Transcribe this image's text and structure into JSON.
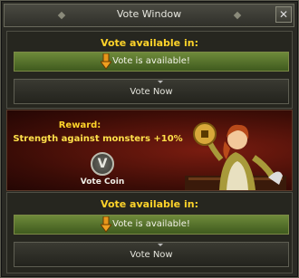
{
  "window": {
    "title": "Vote Window",
    "close_glyph": "✕"
  },
  "sections": [
    {
      "heading": "Vote available in:",
      "status": "Vote is available!",
      "button": "Vote Now"
    },
    {
      "heading": "Vote available in:",
      "status": "Vote is available!",
      "button": "Vote Now"
    }
  ],
  "reward": {
    "title": "Reward:",
    "description": "Strength against monsters +10%",
    "coin_glyph": "V",
    "coin_label": "Vote Coin"
  },
  "colors": {
    "heading": "#ffd42a",
    "status_bar": "#4f6e2a",
    "reward_bg": "#5a120a"
  }
}
